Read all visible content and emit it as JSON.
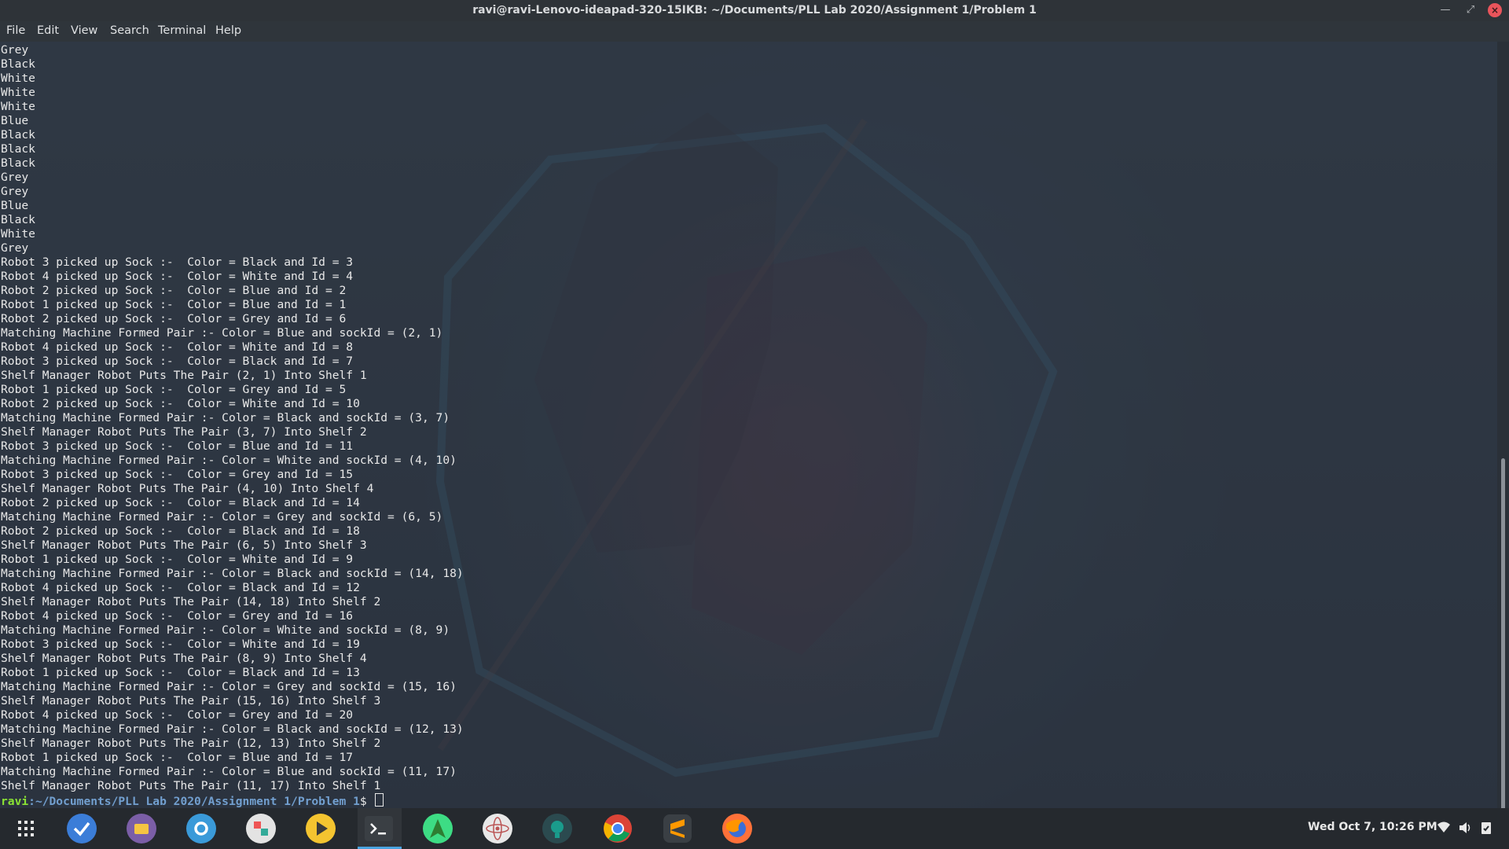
{
  "window": {
    "title": "ravi@ravi-Lenovo-ideapad-320-15IKB: ~/Documents/PLL Lab 2020/Assignment 1/Problem 1"
  },
  "menu": {
    "items": [
      "File",
      "Edit",
      "View",
      "Search",
      "Terminal",
      "Help"
    ]
  },
  "terminal": {
    "lines": [
      "Grey",
      "Black",
      "White",
      "White",
      "White",
      "Blue",
      "Black",
      "Black",
      "Black",
      "Grey",
      "Grey",
      "Blue",
      "Black",
      "White",
      "Grey",
      "Robot 3 picked up Sock :-  Color = Black and Id = 3",
      "Robot 4 picked up Sock :-  Color = White and Id = 4",
      "Robot 2 picked up Sock :-  Color = Blue and Id = 2",
      "Robot 1 picked up Sock :-  Color = Blue and Id = 1",
      "Robot 2 picked up Sock :-  Color = Grey and Id = 6",
      "Matching Machine Formed Pair :- Color = Blue and sockId = (2, 1)",
      "Robot 4 picked up Sock :-  Color = White and Id = 8",
      "Robot 3 picked up Sock :-  Color = Black and Id = 7",
      "Shelf Manager Robot Puts The Pair (2, 1) Into Shelf 1",
      "Robot 1 picked up Sock :-  Color = Grey and Id = 5",
      "Robot 2 picked up Sock :-  Color = White and Id = 10",
      "Matching Machine Formed Pair :- Color = Black and sockId = (3, 7)",
      "Shelf Manager Robot Puts The Pair (3, 7) Into Shelf 2",
      "Robot 3 picked up Sock :-  Color = Blue and Id = 11",
      "Matching Machine Formed Pair :- Color = White and sockId = (4, 10)",
      "Robot 3 picked up Sock :-  Color = Grey and Id = 15",
      "Shelf Manager Robot Puts The Pair (4, 10) Into Shelf 4",
      "Robot 2 picked up Sock :-  Color = Black and Id = 14",
      "Matching Machine Formed Pair :- Color = Grey and sockId = (6, 5)",
      "Robot 2 picked up Sock :-  Color = Black and Id = 18",
      "Shelf Manager Robot Puts The Pair (6, 5) Into Shelf 3",
      "Robot 1 picked up Sock :-  Color = White and Id = 9",
      "Matching Machine Formed Pair :- Color = Black and sockId = (14, 18)",
      "Robot 4 picked up Sock :-  Color = Black and Id = 12",
      "Shelf Manager Robot Puts The Pair (14, 18) Into Shelf 2",
      "Robot 4 picked up Sock :-  Color = Grey and Id = 16",
      "Matching Machine Formed Pair :- Color = White and sockId = (8, 9)",
      "Robot 3 picked up Sock :-  Color = White and Id = 19",
      "Shelf Manager Robot Puts The Pair (8, 9) Into Shelf 4",
      "Robot 1 picked up Sock :-  Color = Black and Id = 13",
      "Matching Machine Formed Pair :- Color = Grey and sockId = (15, 16)",
      "Shelf Manager Robot Puts The Pair (15, 16) Into Shelf 3",
      "Robot 4 picked up Sock :-  Color = Grey and Id = 20",
      "Matching Machine Formed Pair :- Color = Black and sockId = (12, 13)",
      "Shelf Manager Robot Puts The Pair (12, 13) Into Shelf 2",
      "Robot 1 picked up Sock :-  Color = Blue and Id = 17",
      "Matching Machine Formed Pair :- Color = Blue and sockId = (11, 17)",
      "Shelf Manager Robot Puts The Pair (11, 17) Into Shelf 1"
    ],
    "prompt": {
      "user": "ravi",
      "path": ":~/Documents/PLL Lab 2020/Assignment 1/Problem 1",
      "symbol": "$ "
    }
  },
  "taskbar": {
    "apps": [
      {
        "name": "app-launcher-icon",
        "color": "#25292e"
      },
      {
        "name": "tasks-icon",
        "color": "#3b7dd8"
      },
      {
        "name": "files-icon",
        "color": "#7b5ea7"
      },
      {
        "name": "settings-icon",
        "color": "#3a9ad9"
      },
      {
        "name": "switcher-icon",
        "color": "#e3e3e3"
      },
      {
        "name": "media-player-icon",
        "color": "#f4c430"
      },
      {
        "name": "terminal-icon",
        "color": "#3a3f44"
      },
      {
        "name": "android-studio-icon",
        "color": "#3ddc84"
      },
      {
        "name": "atom-icon",
        "color": "#e8e8e8"
      },
      {
        "name": "gitkraken-icon",
        "color": "#2b4a4f"
      },
      {
        "name": "chrome-icon",
        "color": "#db4437"
      },
      {
        "name": "sublime-text-icon",
        "color": "#ff9800"
      },
      {
        "name": "firefox-icon",
        "color": "#ff7139"
      }
    ],
    "clock": "Wed Oct  7, 10:26 PM"
  }
}
